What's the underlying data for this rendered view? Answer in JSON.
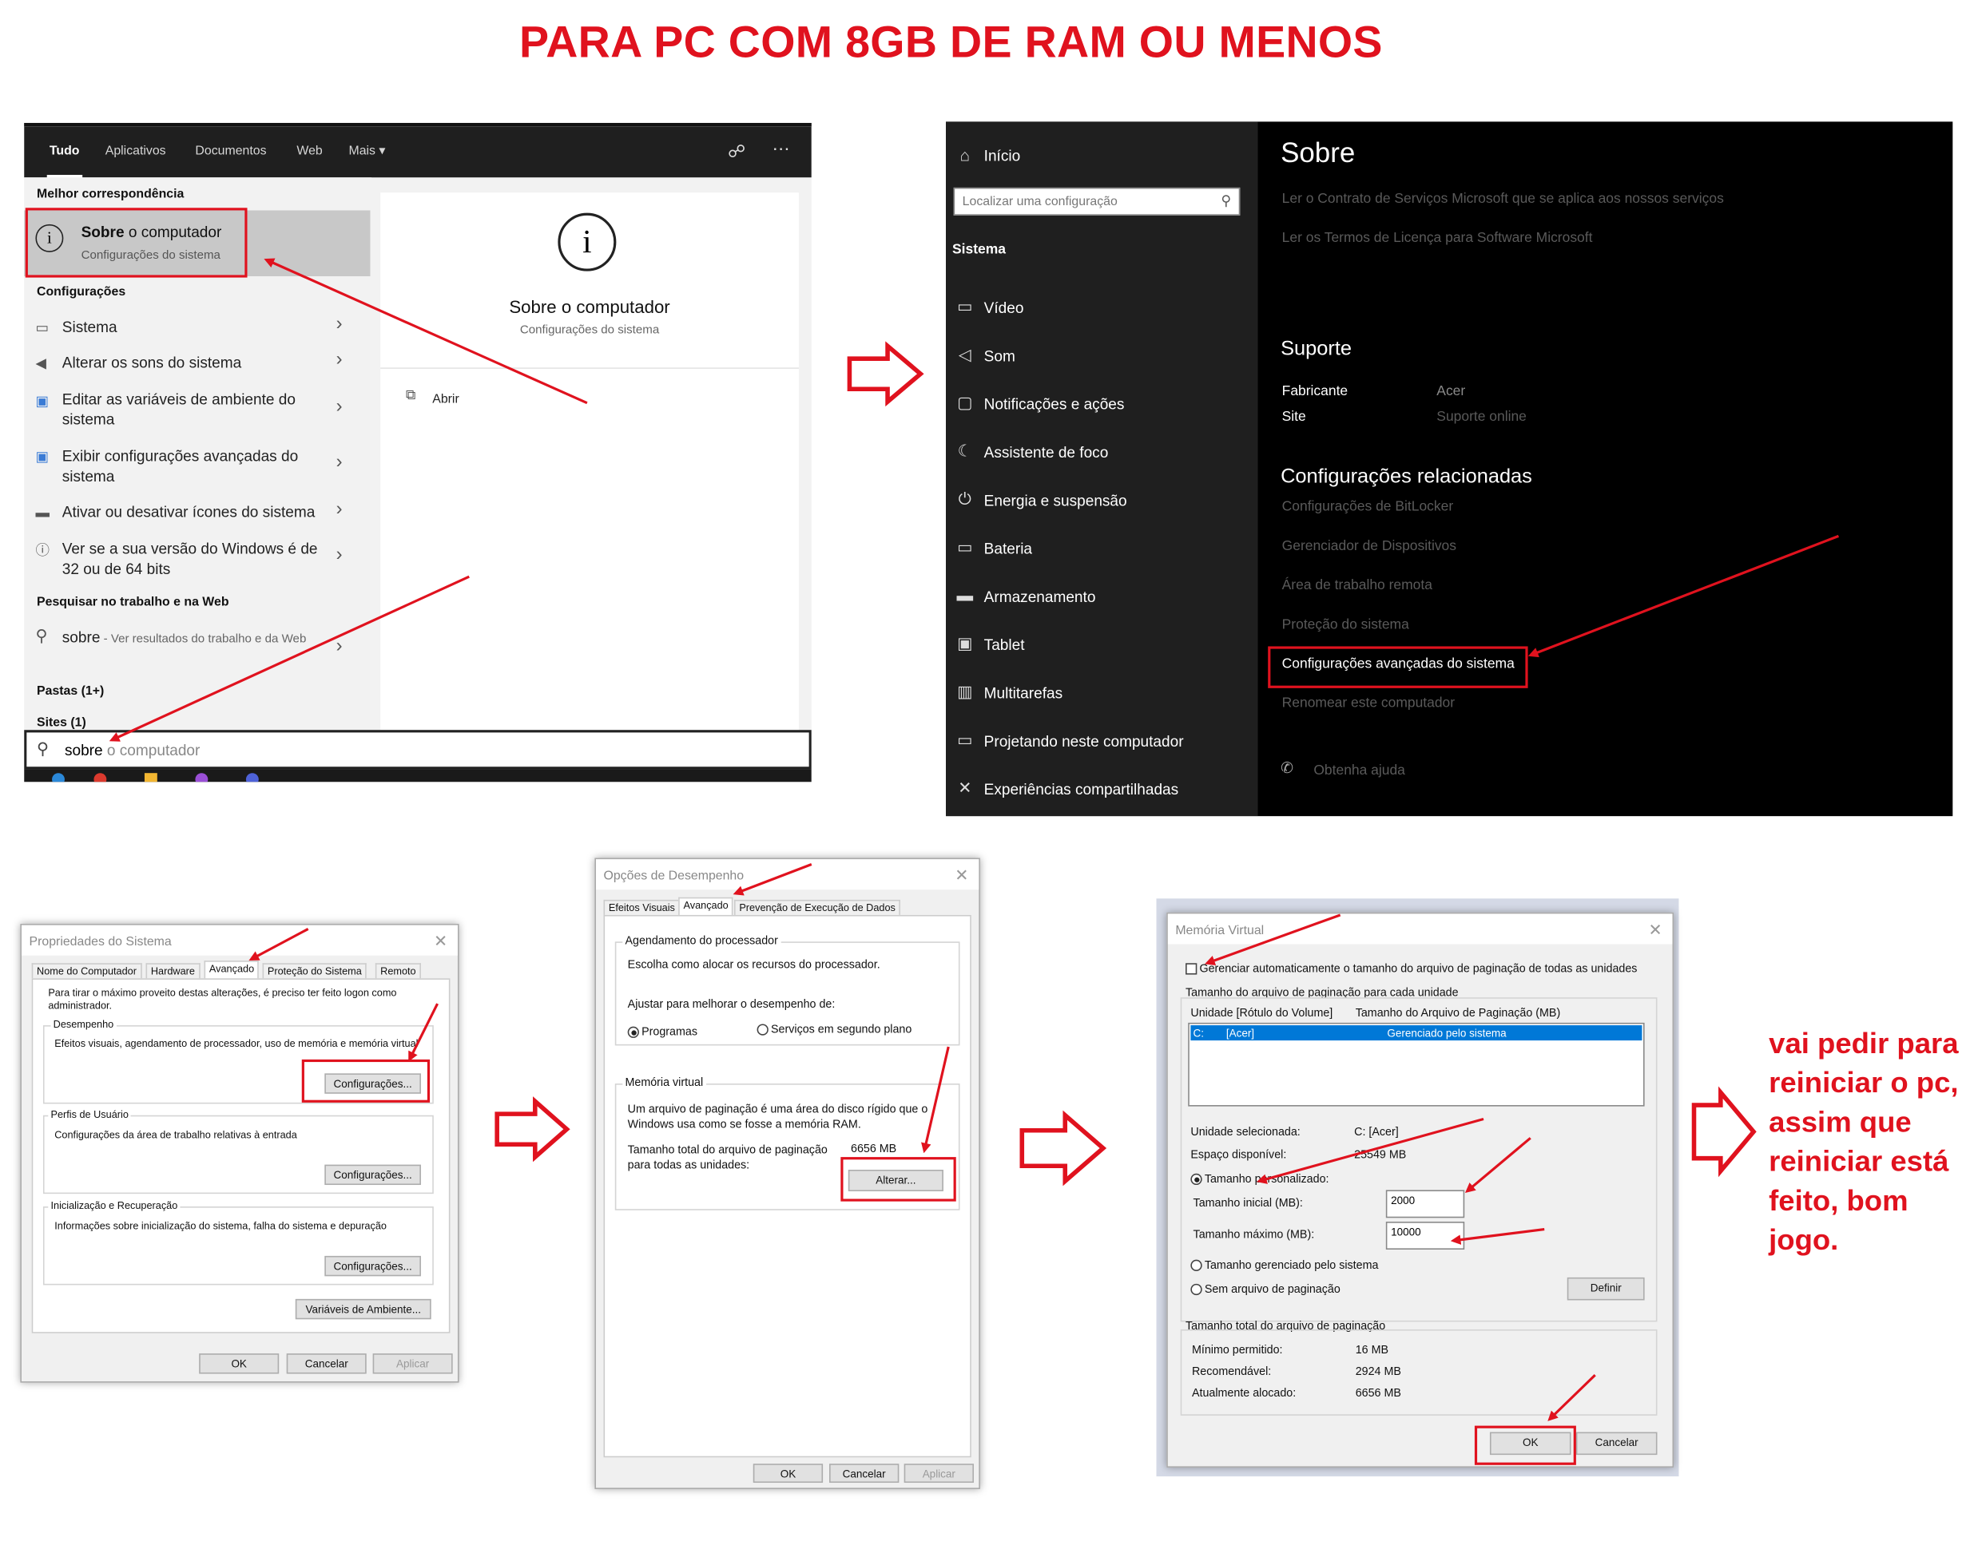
{
  "title": "PARA PC COM 8GB DE RAM OU MENOS",
  "colors": {
    "annotation_red": "#e0121e",
    "selection_blue": "#0078d7",
    "dark_bg": "#1f1f1f"
  },
  "search_panel": {
    "tabs": [
      "Tudo",
      "Aplicativos",
      "Documentos",
      "Web",
      "Mais"
    ],
    "best_match_header": "Melhor correspondência",
    "best_match_title_bold": "Sobre",
    "best_match_title_rest": " o computador",
    "best_match_subtitle": "Configurações do sistema",
    "settings_header": "Configurações",
    "settings_items": [
      {
        "label": "Sistema",
        "icon": "laptop-icon"
      },
      {
        "label": "Alterar os sons do sistema",
        "icon": "speaker-icon"
      },
      {
        "label": "Editar as variáveis de ambiente do sistema",
        "icon": "monitor-icon"
      },
      {
        "label": "Exibir configurações avançadas do sistema",
        "icon": "monitor-icon"
      },
      {
        "label": "Ativar ou desativar ícones do sistema",
        "icon": "taskbar-icon"
      },
      {
        "label": "Ver se a sua versão do Windows é de 32 ou de 64 bits",
        "icon": "info-icon"
      }
    ],
    "web_header": "Pesquisar no trabalho e na Web",
    "web_query": "sobre",
    "web_hint": " - Ver resultados do trabalho e da Web",
    "folders": "Pastas (1+)",
    "sites": "Sites (1)",
    "preview_title": "Sobre o computador",
    "preview_subtitle": "Configurações do sistema",
    "open_label": "Abrir",
    "search_typed": "sobre",
    "search_suggestion": " o computador"
  },
  "settings_panel": {
    "home": "Início",
    "search_placeholder": "Localizar uma configuração",
    "section": "Sistema",
    "nav": [
      {
        "label": "Vídeo",
        "icon": "display-icon"
      },
      {
        "label": "Som",
        "icon": "sound-icon"
      },
      {
        "label": "Notificações e ações",
        "icon": "notification-icon"
      },
      {
        "label": "Assistente de foco",
        "icon": "moon-icon"
      },
      {
        "label": "Energia e suspensão",
        "icon": "power-icon"
      },
      {
        "label": "Bateria",
        "icon": "battery-icon"
      },
      {
        "label": "Armazenamento",
        "icon": "storage-icon"
      },
      {
        "label": "Tablet",
        "icon": "tablet-icon"
      },
      {
        "label": "Multitarefas",
        "icon": "multitask-icon"
      },
      {
        "label": "Projetando neste computador",
        "icon": "project-icon"
      },
      {
        "label": "Experiências compartilhadas",
        "icon": "shared-icon"
      }
    ],
    "page_title": "Sobre",
    "link1": "Ler o Contrato de Serviços Microsoft que se aplica aos nossos serviços",
    "link2": "Ler os Termos de Licença para Software Microsoft",
    "support_header": "Suporte",
    "manufacturer_label": "Fabricante",
    "manufacturer_value": "Acer",
    "site_label": "Site",
    "site_value": "Suporte online",
    "related_header": "Configurações relacionadas",
    "related": [
      "Configurações de BitLocker",
      "Gerenciador de Dispositivos",
      "Área de trabalho remota",
      "Proteção do sistema",
      "Configurações avançadas do sistema",
      "Renomear este computador"
    ],
    "help": "Obtenha ajuda"
  },
  "system_properties": {
    "caption": "Propriedades do Sistema",
    "tabs": [
      "Nome do Computador",
      "Hardware",
      "Avançado",
      "Proteção do Sistema",
      "Remoto"
    ],
    "admin_note": "Para tirar o máximo proveito destas alterações, é preciso ter feito logon como administrador.",
    "performance_header": "Desempenho",
    "performance_text": "Efeitos visuais, agendamento de processador, uso de memória e memória virtual",
    "settings_button": "Configurações...",
    "profiles_header": "Perfis de Usuário",
    "profiles_text": "Configurações da área de trabalho relativas à entrada",
    "startup_header": "Inicialização e Recuperação",
    "startup_text": "Informações sobre inicialização do sistema, falha do sistema e depuração",
    "env_button": "Variáveis de Ambiente...",
    "ok": "OK",
    "cancel": "Cancelar",
    "apply": "Aplicar"
  },
  "performance_options": {
    "caption": "Opções de Desempenho",
    "tabs": [
      "Efeitos Visuais",
      "Avançado",
      "Prevenção de Execução de Dados"
    ],
    "scheduling_header": "Agendamento do processador",
    "scheduling_text": "Escolha como alocar os recursos do processador.",
    "adjust_text": "Ajustar para melhorar o desempenho de:",
    "programs": "Programas",
    "services": "Serviços em segundo plano",
    "vm_header": "Memória virtual",
    "vm_text": "Um arquivo de paginação é uma área do disco rígido que o Windows usa como se fosse a memória RAM.",
    "total_label": "Tamanho total do arquivo de paginação para todas as unidades:",
    "total_value": "6656 MB",
    "change_button": "Alterar...",
    "ok": "OK",
    "cancel": "Cancelar",
    "apply": "Aplicar"
  },
  "virtual_memory": {
    "caption": "Memória Virtual",
    "auto_manage": "Gerenciar automaticamente o tamanho do arquivo de paginação de todas as unidades",
    "per_drive_header": "Tamanho do arquivo de paginação para cada unidade",
    "col_drive": "Unidade [Rótulo do Volume]",
    "col_size": "Tamanho do Arquivo de Paginação (MB)",
    "row_drive": "C:",
    "row_label": "[Acer]",
    "row_size": "Gerenciado pelo sistema",
    "selected_label": "Unidade selecionada:",
    "selected_value": "C:  [Acer]",
    "free_label": "Espaço disponível:",
    "free_value": "25549 MB",
    "custom_size": "Tamanho personalizado:",
    "initial_label": "Tamanho inicial (MB):",
    "initial_value": "2000",
    "max_label": "Tamanho máximo (MB):",
    "max_value": "10000",
    "system_managed": "Tamanho gerenciado pelo sistema",
    "no_paging": "Sem arquivo de paginação",
    "set_button": "Definir",
    "total_header": "Tamanho total do arquivo de paginação",
    "min_label": "Mínimo permitido:",
    "min_value": "16 MB",
    "rec_label": "Recomendável:",
    "rec_value": "2924 MB",
    "cur_label": "Atualmente alocado:",
    "cur_value": "6656 MB",
    "ok": "OK",
    "cancel": "Cancelar"
  },
  "note": "vai pedir para reiniciar o pc, assim que reiniciar está feito, bom jogo."
}
